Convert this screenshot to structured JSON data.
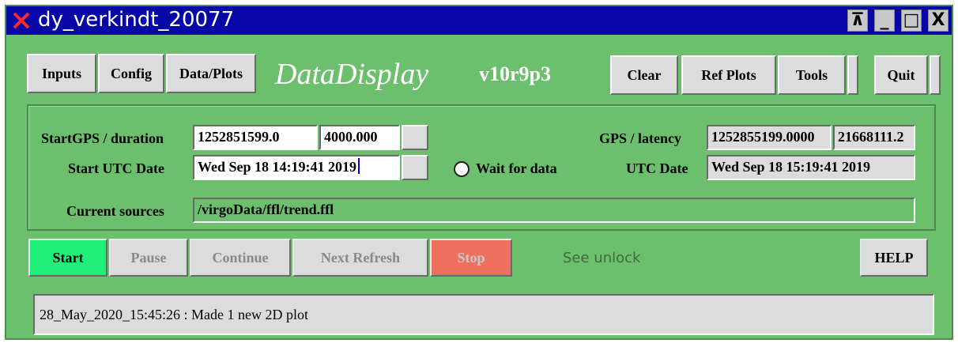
{
  "window": {
    "title": "dy_verkindt_20077",
    "wm_buttons": {
      "pin": "⊼",
      "minimize": "_",
      "maximize": "□",
      "close": "X"
    }
  },
  "toolbar": {
    "inputs": "Inputs",
    "config": "Config",
    "data_plots": "Data/Plots",
    "app_name": "DataDisplay",
    "version": "v10r9p3",
    "clear": "Clear",
    "ref_plots": "Ref Plots",
    "tools": "Tools",
    "quit": "Quit"
  },
  "params": {
    "start_gps_label": "StartGPS / duration",
    "start_gps_value": "1252851599.0",
    "duration_value": "4000.000",
    "start_utc_label": "Start UTC Date",
    "start_utc_value": "Wed Sep 18 14:19:41 2019",
    "wait_for_data_label": "Wait for data",
    "gps_latency_label": "GPS / latency",
    "gps_value": "1252855199.0000",
    "latency_value": "21668111.2",
    "utc_date_label": "UTC Date",
    "utc_date_value": "Wed Sep 18 15:19:41 2019",
    "current_sources_label": "Current sources",
    "current_sources_value": "/virgoData/ffl/trend.ffl"
  },
  "controls": {
    "start": "Start",
    "pause": "Pause",
    "continue": "Continue",
    "next_refresh": "Next Refresh",
    "stop": "Stop",
    "status": "See unlock",
    "help": "HELP"
  },
  "log": {
    "message": "28_May_2020_15:45:26 : Made 1 new 2D plot"
  },
  "colors": {
    "window_bg": "#6cbf6c",
    "titlebar": "#0707a8",
    "start_button": "#1ef07a",
    "stop_button": "#f07060",
    "disabled_text": "#8a8a8a"
  }
}
